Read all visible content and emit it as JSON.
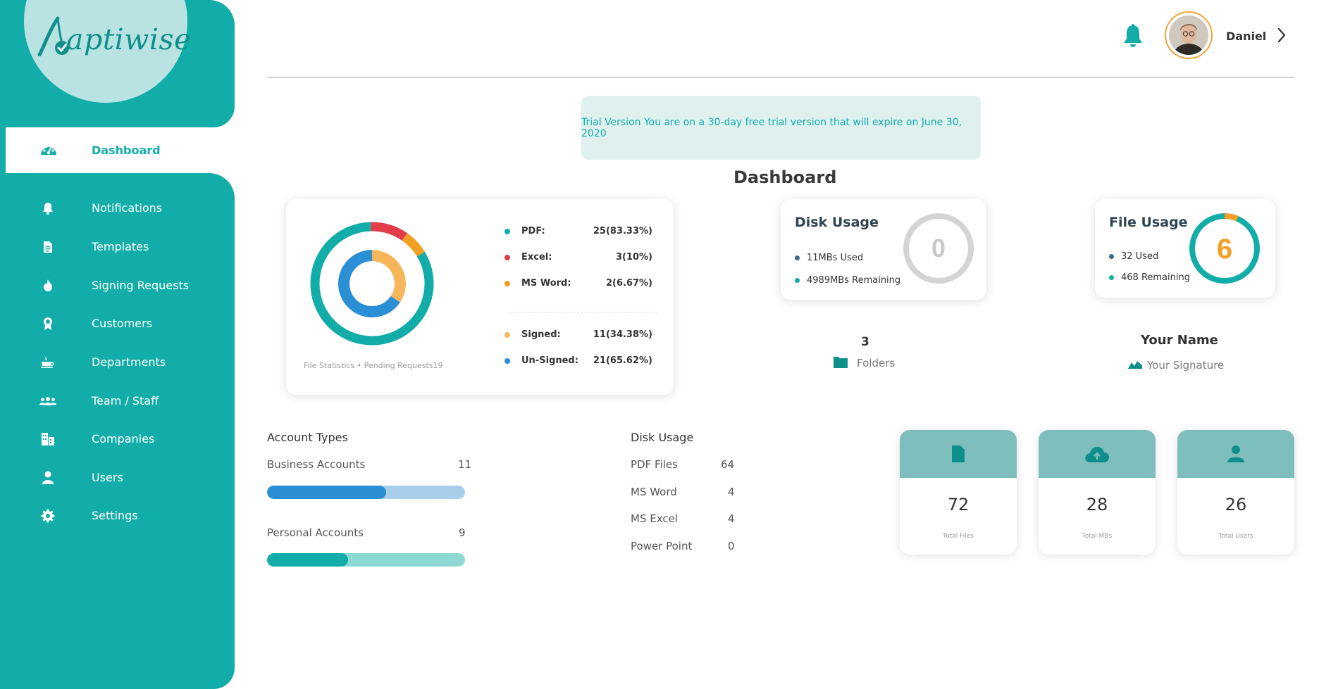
{
  "brand": {
    "logo_text": "aptiwise"
  },
  "sidebar": {
    "active": {
      "label": "Dashboard",
      "icon": "dashboard-gauge-icon"
    },
    "items": [
      {
        "label": "Notifications",
        "icon": "bell-icon"
      },
      {
        "label": "Templates",
        "icon": "document-icon"
      },
      {
        "label": "Signing Requests",
        "icon": "flame-icon"
      },
      {
        "label": "Customers",
        "icon": "award-icon"
      },
      {
        "label": "Departments",
        "icon": "coffee-cup-icon"
      },
      {
        "label": "Team / Staff",
        "icon": "team-icon"
      },
      {
        "label": "Companies",
        "icon": "buildings-icon"
      },
      {
        "label": "Users",
        "icon": "user-icon"
      },
      {
        "label": "Settings",
        "icon": "gear-icon"
      }
    ]
  },
  "header": {
    "user_name": "Daniel"
  },
  "trial_banner": {
    "text": "Trial Version You are on a 30-day free trial version that will expire on June 30, 2020"
  },
  "page_title": "Dashboard",
  "file_statistics": {
    "caption": "File Statistics • Pending Requests19",
    "types": [
      {
        "name": "PDF:",
        "value": "25(83.33%)",
        "color": "#12ada9"
      },
      {
        "name": "Excel:",
        "value": "3(10%)",
        "color": "#e03c4a"
      },
      {
        "name": "MS Word:",
        "value": "2(6.67%)",
        "color": "#f2a024"
      }
    ],
    "status": [
      {
        "name": "Signed:",
        "value": "11(34.38%)",
        "color": "#f7b65a"
      },
      {
        "name": "Un-Signed:",
        "value": "21(65.62%)",
        "color": "#2a8fd4"
      }
    ]
  },
  "chart_data": [
    {
      "type": "pie",
      "categories": [
        "PDF",
        "Excel",
        "MS Word"
      ],
      "values": [
        25,
        3,
        2
      ],
      "colors": [
        "#12ada9",
        "#e03c4a",
        "#f2a024"
      ]
    },
    {
      "type": "pie",
      "categories": [
        "Signed",
        "Un-Signed"
      ],
      "values": [
        11,
        21
      ],
      "colors": [
        "#f7b65a",
        "#2a8fd4"
      ]
    }
  ],
  "disk_usage_card": {
    "title": "Disk Usage",
    "used": "11MBs Used",
    "remaining": "4989MBs Remaining",
    "gauge_value": "0",
    "used_fraction": 0.0,
    "colors": {
      "used": "#3e6a8a",
      "remaining": "#12ada9"
    }
  },
  "file_usage_card": {
    "title": "File Usage",
    "used": "32 Used",
    "remaining": "468 Remaining",
    "gauge_value": "6",
    "used_fraction": 0.064,
    "colors": {
      "used": "#f2a024",
      "remaining": "#12ada9"
    }
  },
  "folders": {
    "count": "3",
    "label": "Folders"
  },
  "signature": {
    "name": "Your Name",
    "label": "Your Signature"
  },
  "account_types": {
    "title": "Account Types",
    "rows": [
      {
        "label": "Business Accounts",
        "value": "11",
        "fraction": 0.6,
        "fill": "#2a8fd4",
        "track": "#a7cfec"
      },
      {
        "label": "Personal Accounts",
        "value": "9",
        "fraction": 0.41,
        "fill": "#12ada9",
        "track": "#8fd9d5"
      }
    ]
  },
  "disk_usage_list": {
    "title": "Disk Usage",
    "rows": [
      {
        "label": "PDF Files",
        "value": "64"
      },
      {
        "label": "MS Word",
        "value": "4"
      },
      {
        "label": "MS Excel",
        "value": "4"
      },
      {
        "label": "Power Point",
        "value": "0"
      }
    ]
  },
  "tiles": [
    {
      "value": "72",
      "label": "Total Files",
      "icon": "file-icon"
    },
    {
      "value": "28",
      "label": "Total MBs",
      "icon": "cloud-upload-icon"
    },
    {
      "value": "26",
      "label": "Total Users",
      "icon": "user-icon"
    }
  ]
}
